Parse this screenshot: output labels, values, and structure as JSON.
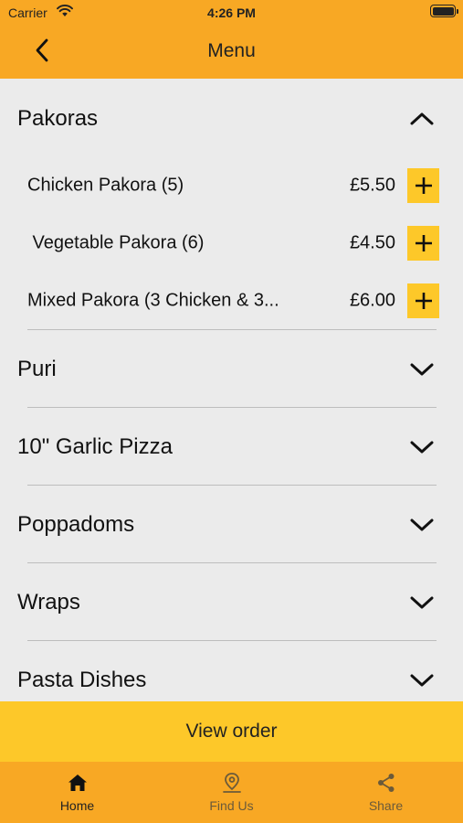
{
  "status_bar": {
    "carrier": "Carrier",
    "time": "4:26 PM"
  },
  "nav": {
    "title": "Menu",
    "back_icon": "chevron-left-icon"
  },
  "colors": {
    "bar": "#f8a824",
    "accent": "#fdc829",
    "background": "#ebebeb"
  },
  "sections": [
    {
      "title": "Pakoras",
      "expanded": true,
      "items": [
        {
          "name": "Chicken Pakora (5)",
          "price": "£5.50"
        },
        {
          "name": " Vegetable Pakora (6)",
          "price": "£4.50"
        },
        {
          "name": "Mixed Pakora (3 Chicken & 3...",
          "price": "£6.00"
        }
      ]
    },
    {
      "title": "Puri",
      "expanded": false
    },
    {
      "title": "10\" Garlic Pizza",
      "expanded": false
    },
    {
      "title": "Poppadoms",
      "expanded": false
    },
    {
      "title": "Wraps",
      "expanded": false
    },
    {
      "title": "Pasta Dishes",
      "expanded": false
    }
  ],
  "view_order_label": "View order",
  "tabs": [
    {
      "label": "Home",
      "icon": "home-icon",
      "active": true
    },
    {
      "label": "Find Us",
      "icon": "location-pin-icon",
      "active": false
    },
    {
      "label": "Share",
      "icon": "share-icon",
      "active": false
    }
  ]
}
